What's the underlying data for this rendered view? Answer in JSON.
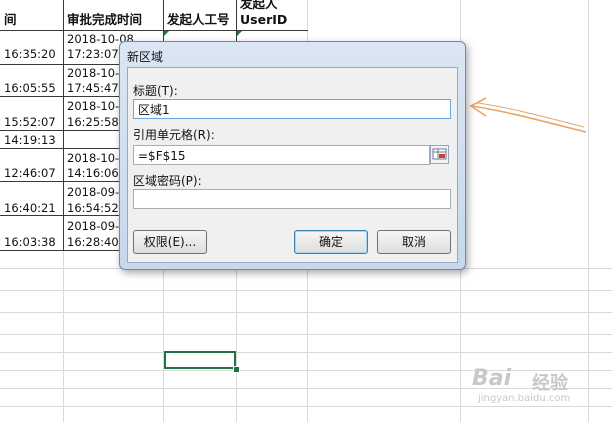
{
  "sheet": {
    "headers": {
      "col_a": "间",
      "col_b": "审批完成时间",
      "col_c": "发起人工号",
      "col_d_line1": "发起人",
      "col_d_line2": "UserID"
    },
    "col_a": [
      "16:35:20",
      "16:05:55",
      "15:52:07",
      "14:19:13",
      "12:46:07",
      "16:40:21",
      "16:03:38"
    ],
    "col_b": [
      [
        "2018-10-08",
        "17:23:07"
      ],
      [
        "2018-10-0",
        "17:45:47"
      ],
      [
        "2018-10-0",
        "16:25:58"
      ],
      [
        "",
        ""
      ],
      [
        "2018-10-0",
        "14:16:06"
      ],
      [
        "2018-09-3",
        "16:54:52"
      ],
      [
        "2018-09-3",
        "16:28:40"
      ]
    ]
  },
  "dialog": {
    "title": "新区域",
    "title_label": "标题(T):",
    "title_value": "区域1",
    "ref_label": "引用单元格(R):",
    "ref_value": "=$F$15",
    "password_label": "区域密码(P):",
    "password_value": "",
    "permissions_button": "权限(E)...",
    "ok_button": "确定",
    "cancel_button": "取消"
  },
  "watermark": {
    "brand": "Bai",
    "brand2": "经验",
    "url": "jingyan.baidu.com"
  },
  "colors": {
    "arrow": "#e8a66a",
    "selection": "#217346"
  }
}
